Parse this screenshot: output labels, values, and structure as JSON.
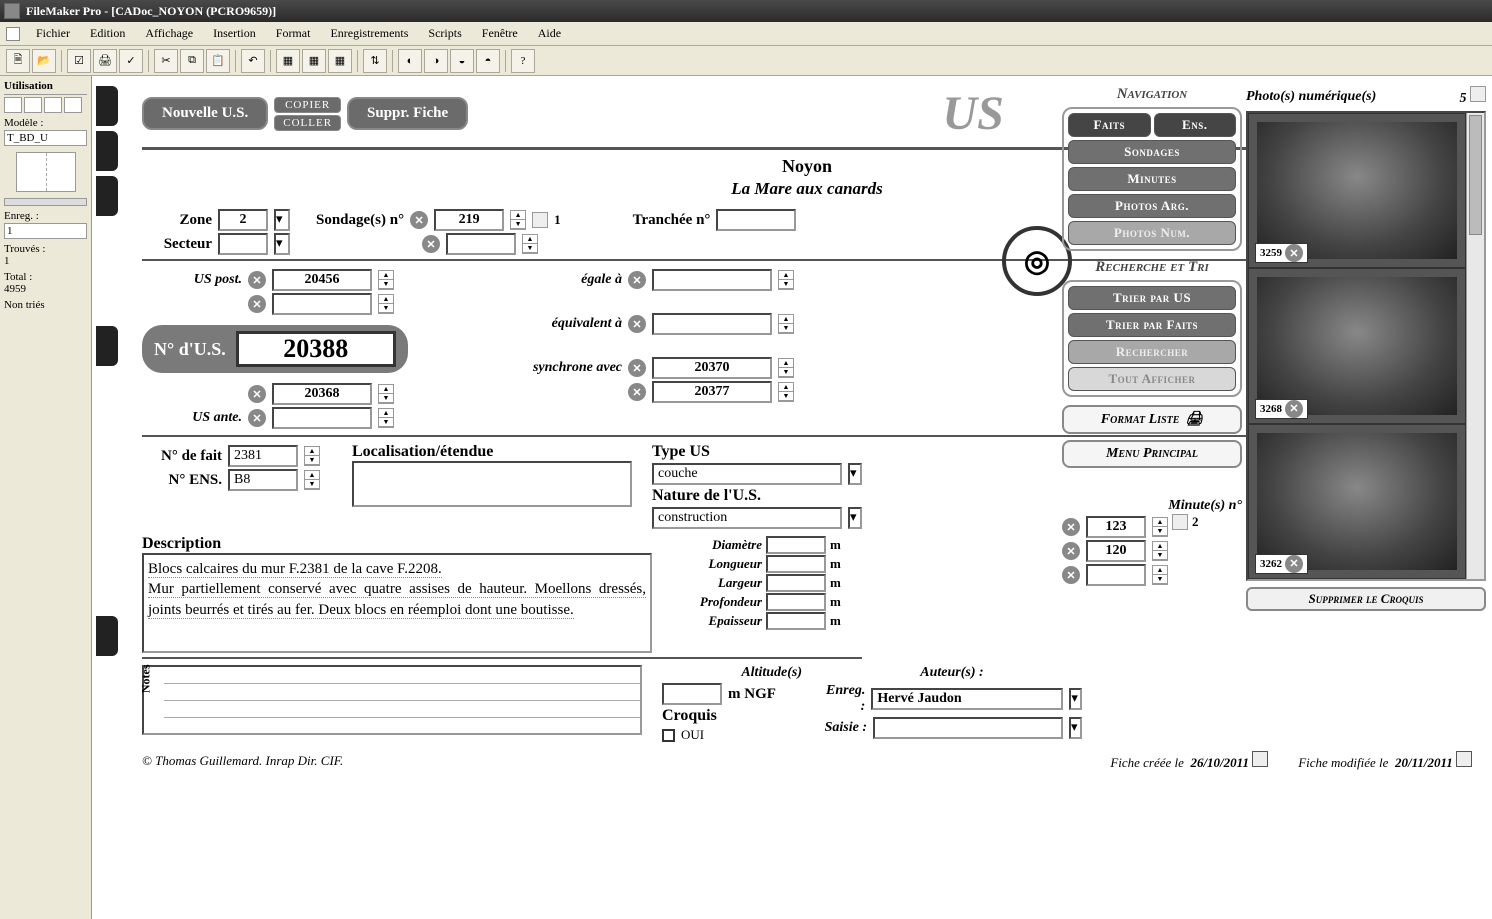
{
  "window": {
    "title": "FileMaker Pro - [CADoc_NOYON (PCRO9659)]"
  },
  "menu": [
    "Fichier",
    "Edition",
    "Affichage",
    "Insertion",
    "Format",
    "Enregistrements",
    "Scripts",
    "Fenêtre",
    "Aide"
  ],
  "sidebar": {
    "header": "Utilisation",
    "model_lbl": "Modèle :",
    "model_val": "T_BD_U",
    "enreg_lbl": "Enreg. :",
    "enreg_val": "1",
    "found_lbl": "Trouvés :",
    "found_val": "1",
    "total_lbl": "Total :",
    "total_val": "4959",
    "sort_lbl": "Non triés"
  },
  "hdr": {
    "nouvelle": "Nouvelle U.S.",
    "copier": "COPIER",
    "coller": "COLLER",
    "suppr": "Suppr. Fiche",
    "us": "US"
  },
  "site": {
    "name": "Noyon",
    "sub": "La Mare aux canards"
  },
  "zone": {
    "lbl": "Zone",
    "val": "2",
    "secteur_lbl": "Secteur",
    "secteur_val": ""
  },
  "sondage": {
    "lbl": "Sondage(s) n°",
    "val": "219",
    "count": "1"
  },
  "tranchee": {
    "lbl": "Tranchée n°",
    "val": ""
  },
  "uspost": {
    "lbl": "US post.",
    "val": "20456"
  },
  "usante": {
    "lbl": "US ante.",
    "val": "20368"
  },
  "usnum": {
    "lbl": "N° d'U.S.",
    "val": "20388"
  },
  "egale": {
    "lbl": "égale à",
    "val": ""
  },
  "equiv": {
    "lbl": "équivalent à",
    "val": ""
  },
  "sync": {
    "lbl": "synchrone avec",
    "v1": "20370",
    "v2": "20377"
  },
  "fait": {
    "lbl": "N° de fait",
    "val": "2381"
  },
  "ens": {
    "lbl": "N° ENS.",
    "val": "B8"
  },
  "loc": {
    "lbl": "Localisation/étendue",
    "val": ""
  },
  "typeus": {
    "lbl": "Type US",
    "val": "couche"
  },
  "nature": {
    "lbl": "Nature de l'U.S.",
    "val": "construction"
  },
  "desc": {
    "lbl": "Description",
    "l1": "Blocs calcaires du mur F.2381 de la cave F.2208.",
    "l2": "Mur partiellement conservé avec quatre assises de hauteur. Moellons dressés, joints beurrés et tirés au fer. Deux blocs en réemploi dont une boutisse."
  },
  "meas": {
    "diam": "Diamètre",
    "long": "Longueur",
    "larg": "Largeur",
    "prof": "Profondeur",
    "epai": "Epaisseur",
    "unit": "m"
  },
  "alt": {
    "lbl": "Altitude(s)",
    "unit": "m NGF"
  },
  "croquis": {
    "lbl": "Croquis",
    "opt": "OUI"
  },
  "notes": {
    "lbl": "Notes"
  },
  "copyright": "© Thomas Guillemard. Inrap Dir. CIF.",
  "created": {
    "lbl": "Fiche créée le",
    "val": "26/10/2011"
  },
  "modified": {
    "lbl": "Fiche modifiée le",
    "val": "20/11/2011"
  },
  "auteur": {
    "hdr": "Auteur(s) :",
    "enreg_lbl": "Enreg. :",
    "enreg_val": "Hervé Jaudon",
    "saisie_lbl": "Saisie :",
    "saisie_val": ""
  },
  "nav": {
    "hdr": "Navigation",
    "faits": "Faits",
    "ens": "Ens.",
    "sond": "Sondages",
    "min": "Minutes",
    "parg": "Photos Arg.",
    "pnum": "Photos Num.",
    "search_hdr": "Recherche et Tri",
    "tri_us": "Trier par US",
    "tri_f": "Trier par Faits",
    "rech": "Rechercher",
    "tout": "Tout Afficher",
    "fmt": "Format Liste",
    "menu": "Menu Principal"
  },
  "minutes": {
    "lbl": "Minute(s) n°",
    "v1": "123",
    "v2": "120",
    "count": "2"
  },
  "photos": {
    "lbl": "Photo(s) numérique(s)",
    "count": "5",
    "p1": "3259",
    "p2": "3268",
    "p3": "3262",
    "suppr": "Supprimer le Croquis"
  }
}
